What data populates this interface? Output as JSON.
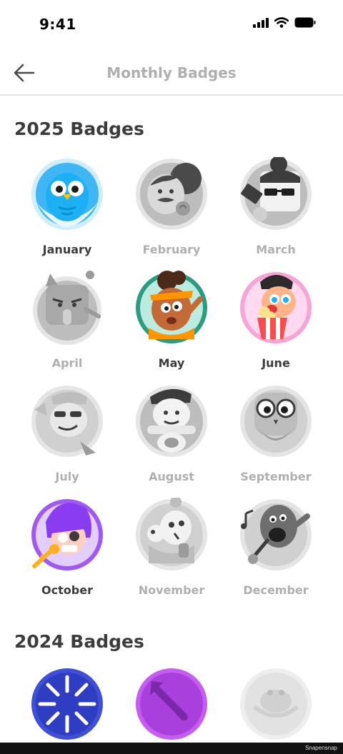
{
  "status_bar": {
    "time": "9:41"
  },
  "header": {
    "title": "Monthly Badges"
  },
  "sections": [
    {
      "title": "2025 Badges",
      "badges": [
        {
          "label": "January",
          "earned": true
        },
        {
          "label": "February",
          "earned": false
        },
        {
          "label": "March",
          "earned": false
        },
        {
          "label": "April",
          "earned": false
        },
        {
          "label": "May",
          "earned": true
        },
        {
          "label": "June",
          "earned": true
        },
        {
          "label": "July",
          "earned": false
        },
        {
          "label": "August",
          "earned": false
        },
        {
          "label": "September",
          "earned": false
        },
        {
          "label": "October",
          "earned": true
        },
        {
          "label": "November",
          "earned": false
        },
        {
          "label": "December",
          "earned": false
        }
      ]
    },
    {
      "title": "2024 Badges"
    }
  ],
  "watermark": "Snapensnap"
}
